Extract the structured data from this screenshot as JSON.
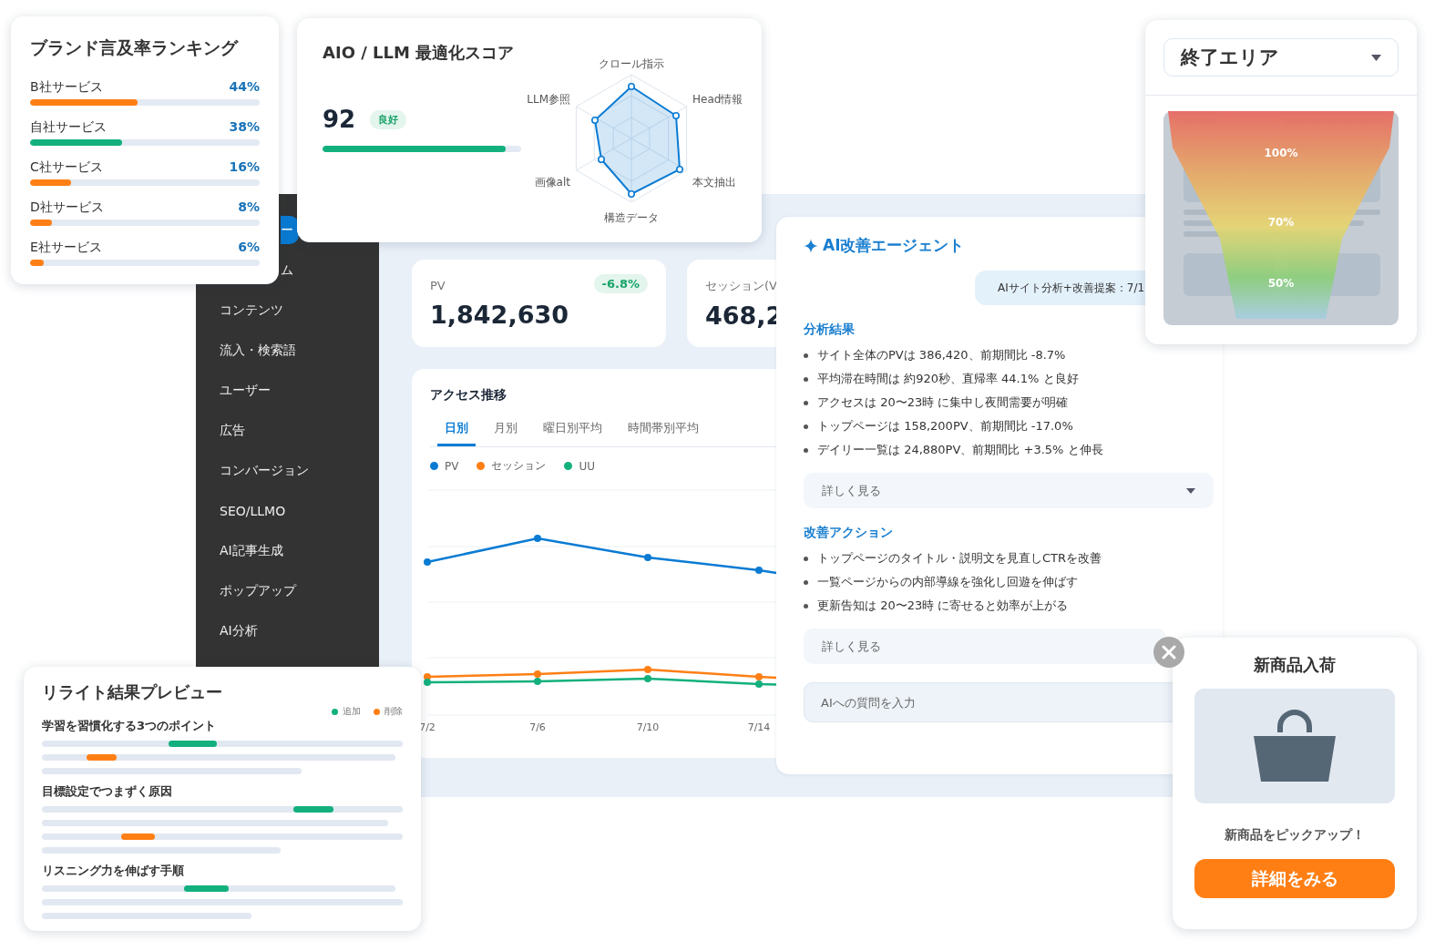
{
  "brand_ranking": {
    "title": "ブランド言及率ランキング",
    "items": [
      {
        "name": "B社サービス",
        "value": "44%",
        "level": 0.47,
        "color": "#ff7f15"
      },
      {
        "name": "自社サービス",
        "value": "38%",
        "level": 0.4,
        "color": "#13b07e"
      },
      {
        "name": "C社サービス",
        "value": "16%",
        "level": 0.18,
        "color": "#ff7f15"
      },
      {
        "name": "D社サービス",
        "value": "8%",
        "level": 0.095,
        "color": "#ff7f15"
      },
      {
        "name": "E社サービス",
        "value": "6%",
        "level": 0.06,
        "color": "#ff7f15"
      }
    ]
  },
  "aio_score": {
    "title": "AIO / LLM 最適化スコア",
    "score": "92",
    "badge": "良好",
    "level": 0.92,
    "radar_labels": [
      "クロール指示",
      "Head情報",
      "本文抽出",
      "構造データ",
      "画像alt",
      "LLM参照"
    ]
  },
  "sidebar": {
    "items": [
      {
        "label": "ー",
        "selected": true,
        "clipped": true
      },
      {
        "label": "ム",
        "selected": false,
        "clipped": true
      },
      {
        "label": "コンテンツ",
        "selected": false,
        "clipped": false
      },
      {
        "label": "流入・検索語",
        "selected": false,
        "clipped": false
      },
      {
        "label": "ユーザー",
        "selected": false,
        "clipped": false
      },
      {
        "label": "広告",
        "selected": false,
        "clipped": false
      },
      {
        "label": "コンバージョン",
        "selected": false,
        "clipped": false
      },
      {
        "label": "SEO/LLMO",
        "selected": false,
        "clipped": false
      },
      {
        "label": "AI記事生成",
        "selected": false,
        "clipped": false
      },
      {
        "label": "ポップアップ",
        "selected": false,
        "clipped": false
      },
      {
        "label": "AI分析",
        "selected": false,
        "clipped": false
      }
    ]
  },
  "kpis": [
    {
      "label": "PV",
      "value": "1,842,630",
      "change": "-6.8%"
    },
    {
      "label": "セッション(V",
      "value": "468,2"
    }
  ],
  "access_chart": {
    "title": "アクセス推移",
    "tabs": [
      {
        "label": "日別",
        "selected": true
      },
      {
        "label": "月別",
        "selected": false
      },
      {
        "label": "曜日別平均",
        "selected": false
      },
      {
        "label": "時間帯別平均",
        "selected": false
      }
    ],
    "series": [
      {
        "name": "PV",
        "color": "#0a7bd3"
      },
      {
        "name": "セッション",
        "color": "#ff7f15"
      },
      {
        "name": "UU",
        "color": "#13b07e"
      }
    ],
    "x_labels": [
      "7/2",
      "7/6",
      "7/10",
      "7/14"
    ]
  },
  "agent": {
    "title": "AI改善エージェント",
    "message": "AIサイト分析+改善提案：7/1",
    "sections": [
      {
        "heading": "分析結果",
        "bullets": [
          "サイト全体のPVは 386,420、前期間比 -8.7%",
          "平均滞在時間は 約920秒、直帰率 44.1% と良好",
          "アクセスは 20〜23時 に集中し夜間需要が明確",
          "トップページは 158,200PV、前期間比 -17.0%",
          "デイリー一覧は 24,880PV、前期間比 +3.5% と伸長"
        ],
        "more": {
          "label": "詳しく見る",
          "caret": true
        }
      },
      {
        "heading": "改善アクション",
        "bullets": [
          "トップページのタイトル・説明文を見直しCTRを改善",
          "一覧ページからの内部導線を強化し回遊を伸ばす",
          "更新告知は 20〜23時 に寄せると効率が上がる"
        ],
        "more": {
          "label": "詳しく見る",
          "caret": false
        }
      }
    ],
    "input": {
      "placeholder": "AIへの質問を入力"
    }
  },
  "funnel": {
    "dropdown": "終了エリア",
    "labels": [
      "100%",
      "70%",
      "50%"
    ]
  },
  "rewrite_preview": {
    "title": "リライト結果プレビュー",
    "legend": [
      {
        "label": "追加",
        "color": "#13b07e"
      },
      {
        "label": "削除",
        "color": "#ff7f15"
      }
    ],
    "sections": [
      "学習を習慣化する3つのポイント",
      "目標設定でつまずく原因",
      "リスニング力を伸ばす手順"
    ]
  },
  "popup": {
    "title": "新商品入荷",
    "text": "新商品をピックアップ！",
    "button": "詳細をみる"
  }
}
